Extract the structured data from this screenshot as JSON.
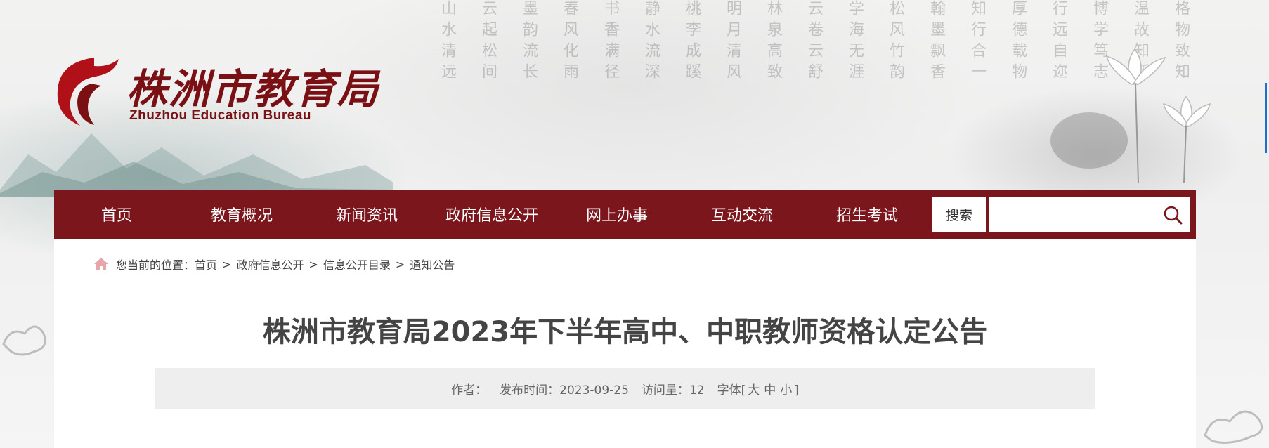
{
  "header": {
    "logo_cn": "株洲市教育局",
    "logo_en": "Zhuzhou Education Bureau"
  },
  "nav": {
    "items": [
      {
        "label": "首页"
      },
      {
        "label": "教育概况"
      },
      {
        "label": "新闻资讯"
      },
      {
        "label": "政府信息公开"
      },
      {
        "label": "网上办事"
      },
      {
        "label": "互动交流"
      },
      {
        "label": "招生考试"
      }
    ],
    "search_label": "搜索",
    "search_value": "",
    "search_icon": "search-icon"
  },
  "breadcrumb": {
    "prefix": "您当前的位置：",
    "items": [
      "首页",
      "政府信息公开",
      "信息公开目录",
      "通知公告"
    ],
    "separator": ">",
    "icon": "home-icon"
  },
  "article": {
    "title": "株洲市教育局2023年下半年高中、中职教师资格认定公告",
    "author_label": "作者：",
    "publish_label": "发布时间：",
    "publish_date": "2023-09-25",
    "views_label": "访问量：",
    "views": "12",
    "font_label": "字体[",
    "font_large": "大",
    "font_medium": "中",
    "font_small": "小",
    "font_close": "]"
  },
  "colors": {
    "nav_bg": "#7a161c",
    "logo_red": "#7a0f14",
    "accent_blue": "#1e6fd0"
  }
}
